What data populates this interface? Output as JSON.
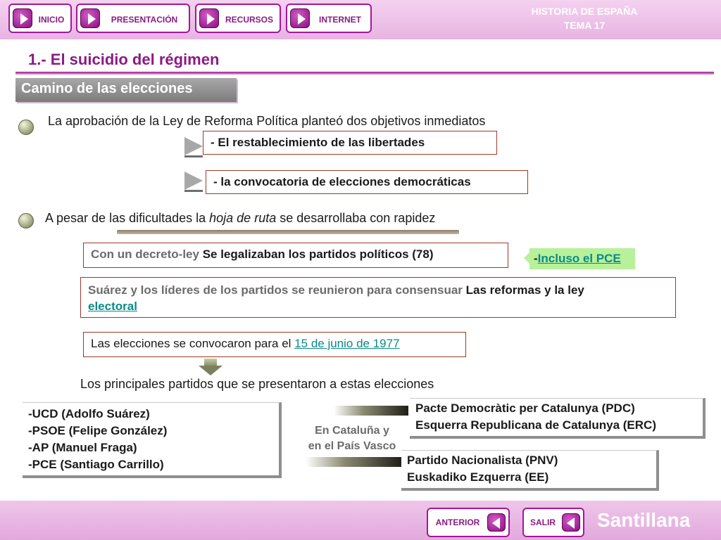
{
  "nav": {
    "inicio": "INICIO",
    "presentacion": "PRESENTACIÓN",
    "recursos": "RECURSOS",
    "internet": "INTERNET",
    "header_line1": "HISTORIA DE ESPAÑA",
    "header_line2": "TEMA 17"
  },
  "main": {
    "title": "1.- El suicidio del régimen",
    "subtitle": "Camino de las elecciones",
    "point1": "La aprobación de la Ley de Reforma Política planteó dos objetivos inmediatos",
    "objective1_prefix": "- ",
    "objective1": "El restablecimiento de las libertades",
    "objective2_prefix": "- ",
    "objective2": "la convocatoria de elecciones democráticas",
    "point2_before": "A pesar de las dificultades la ",
    "point2_italic": "hoja de ruta",
    "point2_after": " se desarrollaba con rapidez",
    "decree_gray": "Con un decreto-ley ",
    "decree_dark": "Se legalizaban los partidos políticos (78)",
    "pce_prefix": "-",
    "pce_link": "Incluso el PCE",
    "suarez_gray": "Suárez y los líderes de los partidos se reunieron para consensuar ",
    "suarez_dark": "Las reformas y la ley ",
    "suarez_link": "electoral",
    "elections_text": "Las elecciones se convocaron para el ",
    "elections_link": "15 de junio de 1977",
    "parties_intro": "Los principales partidos que se presentaron a estas elecciones",
    "national_parties": [
      "-UCD (Adolfo Suárez)",
      "-PSOE (Felipe González)",
      "-AP (Manuel Fraga)",
      "-PCE (Santiago Carrillo)"
    ],
    "region_line1": "En Cataluña y",
    "region_line2": "en el País Vasco",
    "catalan_parties": [
      "Pacte Democràtic per Catalunya (PDC)",
      "Esquerra Republicana de Catalunya (ERC)"
    ],
    "basque_parties": [
      "Partido Nacionalista (PNV)",
      "Euskadiko Ezquerra (EE)"
    ]
  },
  "footer": {
    "anterior": "ANTERIOR",
    "salir": "SALIR",
    "brand": "Santillana"
  },
  "colors": {
    "accent": "#8a1b84",
    "header_bg": "#e8b3e3",
    "link": "#0a8a8a",
    "highlight": "#b7f19a"
  },
  "icons": {
    "nav": "play-icon",
    "back": "back-icon",
    "bullet": "bullet-icon"
  }
}
